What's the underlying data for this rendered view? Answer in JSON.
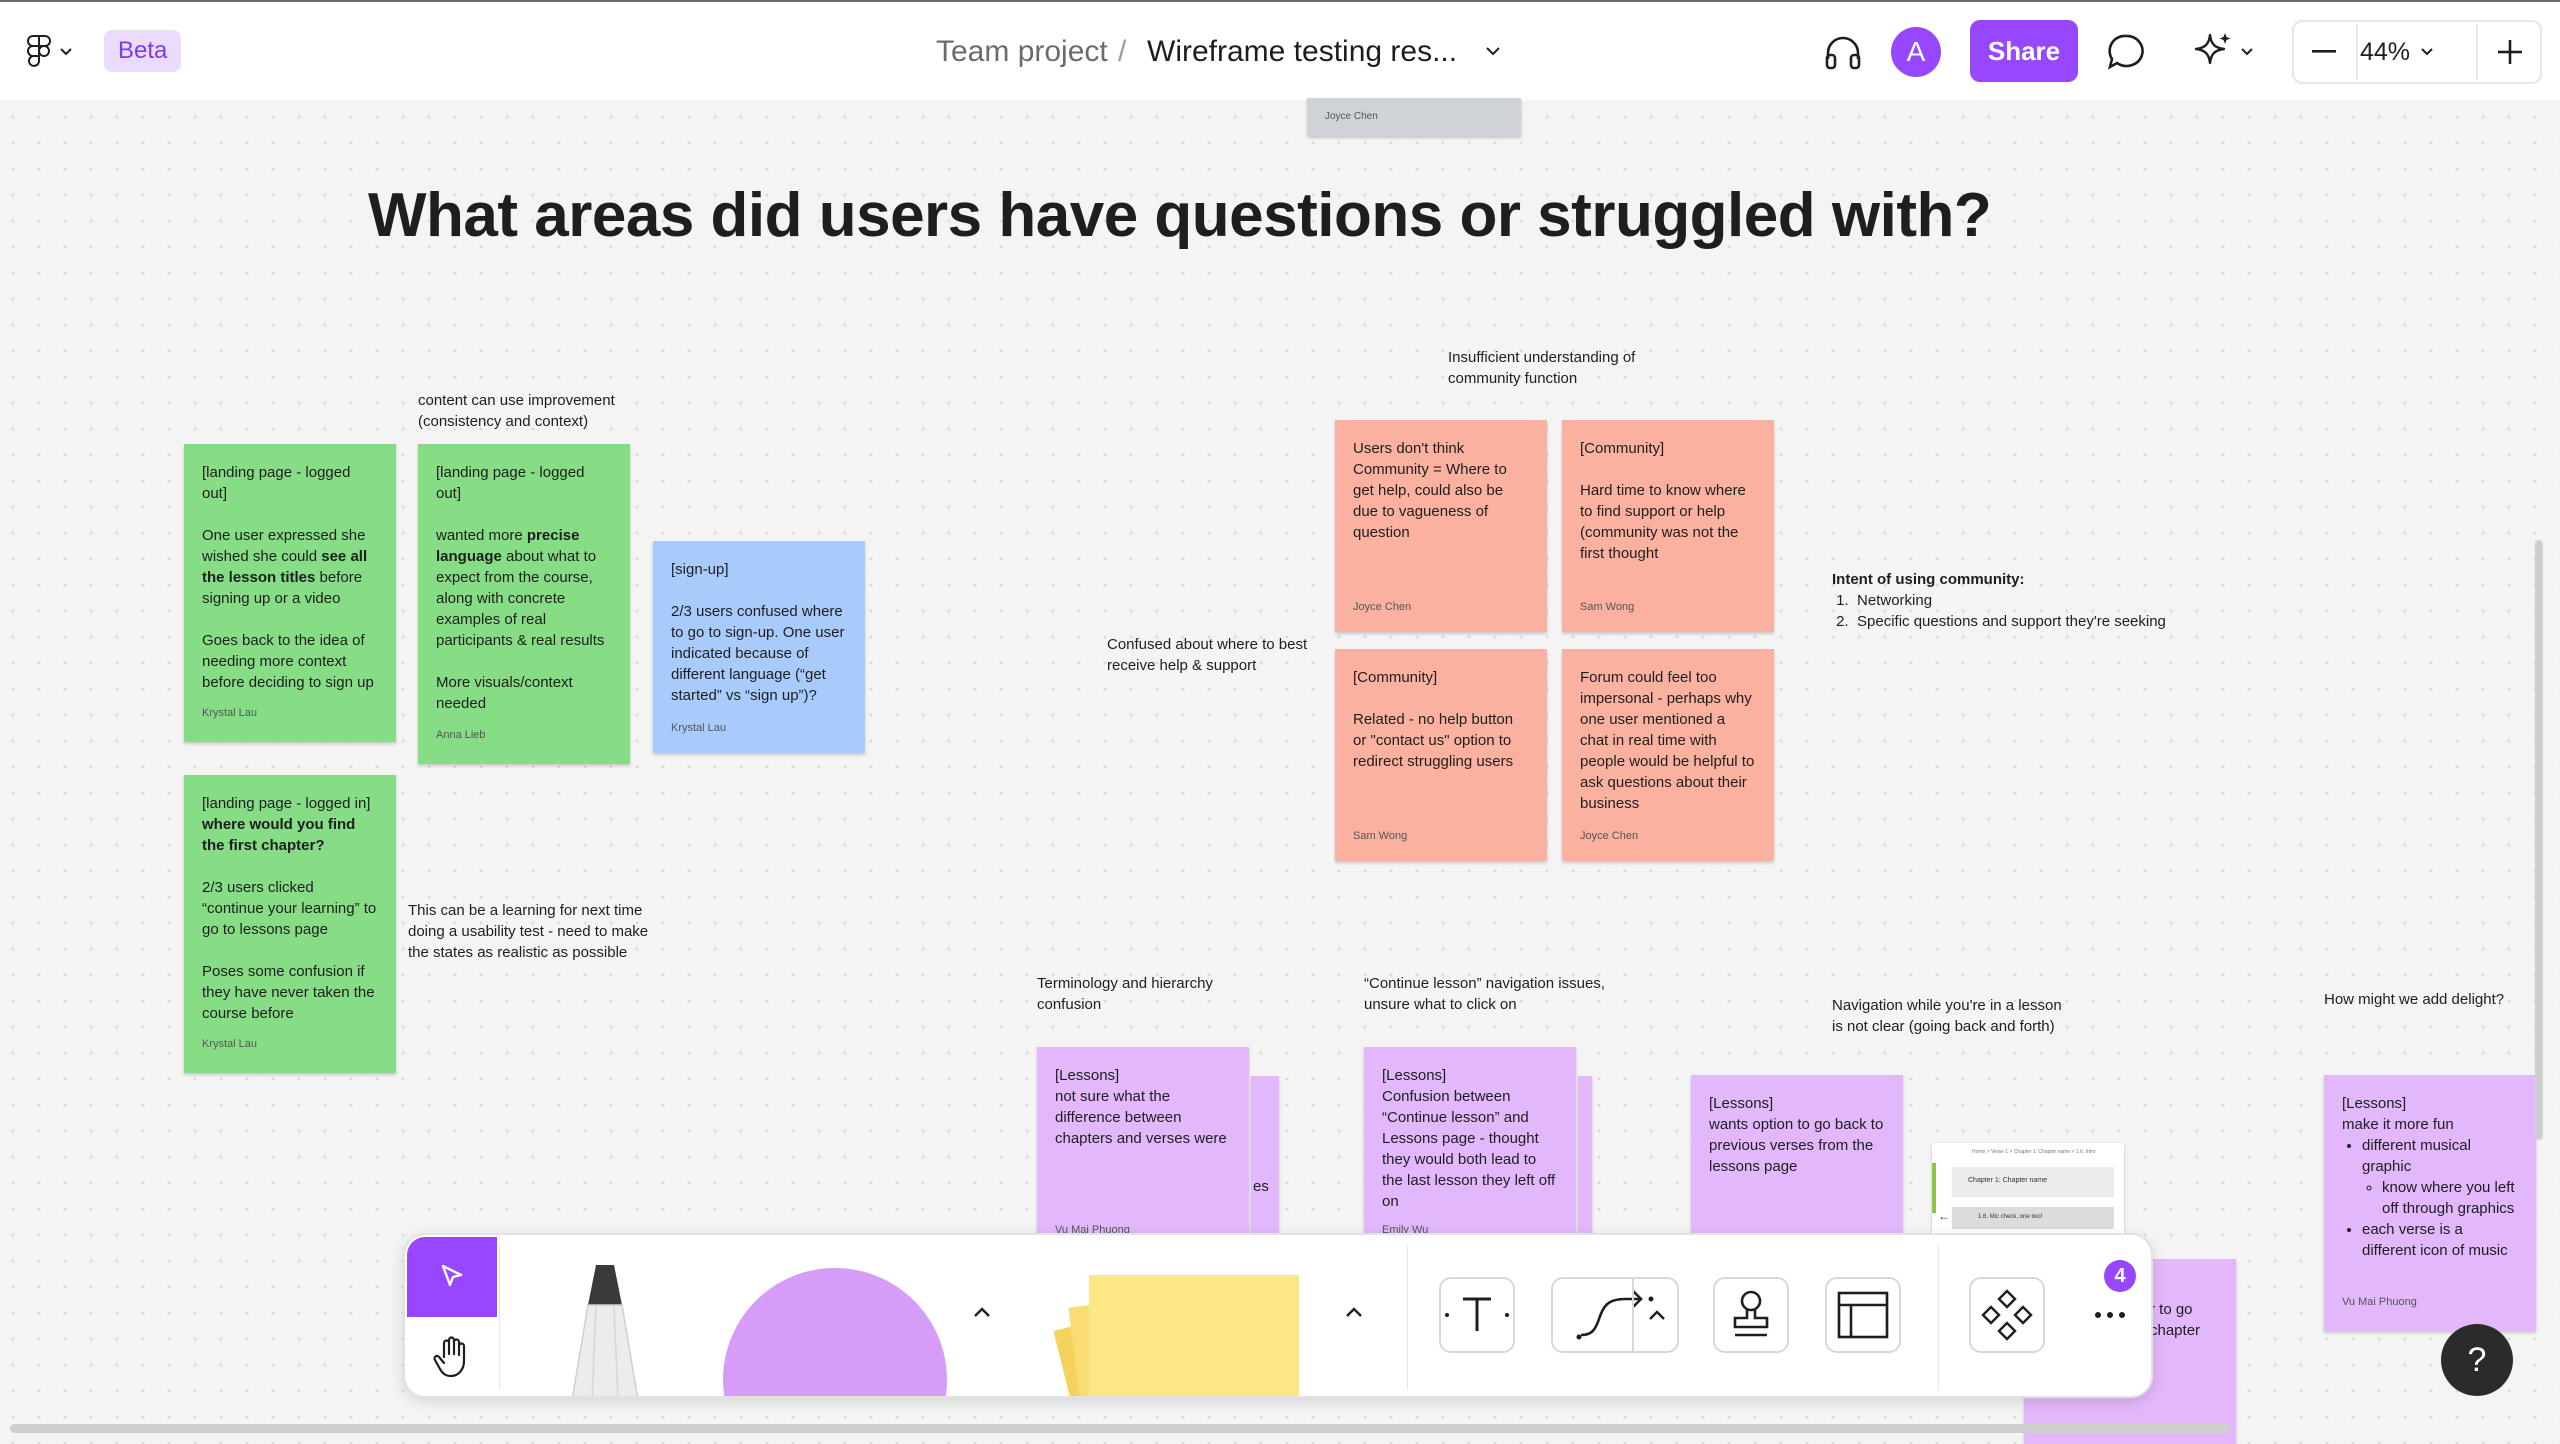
{
  "header": {
    "beta_label": "Beta",
    "breadcrumb_team": "Team project",
    "breadcrumb_separator": "/",
    "file_name": "Wireframe testing res...",
    "avatar_initial": "A",
    "share_label": "Share",
    "zoom_level": "44%",
    "accent_color": "#9747ff"
  },
  "canvas": {
    "title": "What areas did users have questions or struggled with?",
    "top_card_author": "Joyce Chen",
    "labels": {
      "content_improvement": "content can use improvement (consistency and context)",
      "community_understanding": "Insufficient understanding of community function",
      "confused_help": "Confused about where to best receive help & support",
      "intent_title": "Intent of using community:",
      "intent_items": [
        "Networking",
        "Specific questions and support they're seeking"
      ],
      "learning_next_time": "This can be a learning for next time doing a usability test - need to make the states as realistic as possible",
      "terminology": "Terminology and hierarchy confusion",
      "continue_lesson_nav": "“Continue lesson” navigation issues, unsure what to click on",
      "navigation_in_lesson": "Navigation while you're in a lesson is not clear (going back and forth)",
      "delight": "How might we add delight?"
    },
    "notes": {
      "g1": {
        "tag": "[landing page - logged out]",
        "pre": "One user expressed she wished she could ",
        "bold": "see all the lesson titles",
        "post": " before signing up or a video",
        "p2": "Goes back to the idea of needing more context before deciding to sign up",
        "author": "Krystal Lau"
      },
      "g2": {
        "tag": "[landing page - logged out]",
        "pre": "wanted more ",
        "bold": "precise language",
        "post": " about what to expect from the course, along with concrete examples of real participants & real results",
        "p2": "More visuals/context needed",
        "author": "Anna Lieb"
      },
      "b1": {
        "tag": "[sign-up]",
        "body": "2/3 users confused where to go to sign-up. One user indicated because of different language (“get started” vs “sign up”)?",
        "author": "Krystal Lau"
      },
      "g3": {
        "tag": "[landing page - logged in]",
        "bold": "where would you find the first chapter?",
        "p1": "2/3 users clicked “continue your learning” to go to lessons page",
        "p2": "Poses some confusion if they have never taken the course before",
        "author": "Krystal Lau"
      },
      "s1": {
        "body": "Users don't think Community = Where to get help, could also be due to vagueness of question",
        "author": "Joyce Chen"
      },
      "s2": {
        "tag": "[Community]",
        "body": "Hard time to know where to find support or help (community was not the first thought",
        "author": "Sam Wong"
      },
      "s3": {
        "tag": "[Community]",
        "body": "Related - no help button or \"contact us\" option to redirect struggling users",
        "author": "Sam Wong"
      },
      "s4": {
        "body": "Forum could feel too impersonal - perhaps why one user mentioned a chat in real time with people would be helpful to ask questions about their business",
        "author": "Joyce Chen"
      },
      "p1": {
        "tag": "[Lessons]",
        "body": "not sure what the difference between chapters and verses were",
        "author": "Vu Mai Phuong",
        "behind_fragment": "es"
      },
      "p2": {
        "tag": "[Lessons]",
        "body": "Confusion between “Continue lesson” and Lessons page - thought they would both lead to the last lesson they left off on",
        "author": "Emily Wu"
      },
      "p3": {
        "tag": "[Lessons]",
        "body": "wants option to go back to previous verses from the lessons page"
      },
      "p4": {
        "tag": "[Lessons]",
        "intro": "make it more fun",
        "li1": "different musical graphic",
        "li1_sub": "know where you left off through graphics",
        "li2": "each verse is a different icon of music",
        "author": "Vu Mai Phuong"
      },
      "p5": {
        "line1": "r to go",
        "line2": "chapter"
      }
    },
    "wireframe_thumb": {
      "breadcrumb": "Home > Verse 1 > Chapter 1: Chapter name > 1.6. Intro",
      "chapter": "Chapter 1: Chapter name",
      "item": "1.6. Mic check, one two!"
    }
  },
  "toolbar": {
    "badge_count": "4"
  },
  "help_label": "?"
}
